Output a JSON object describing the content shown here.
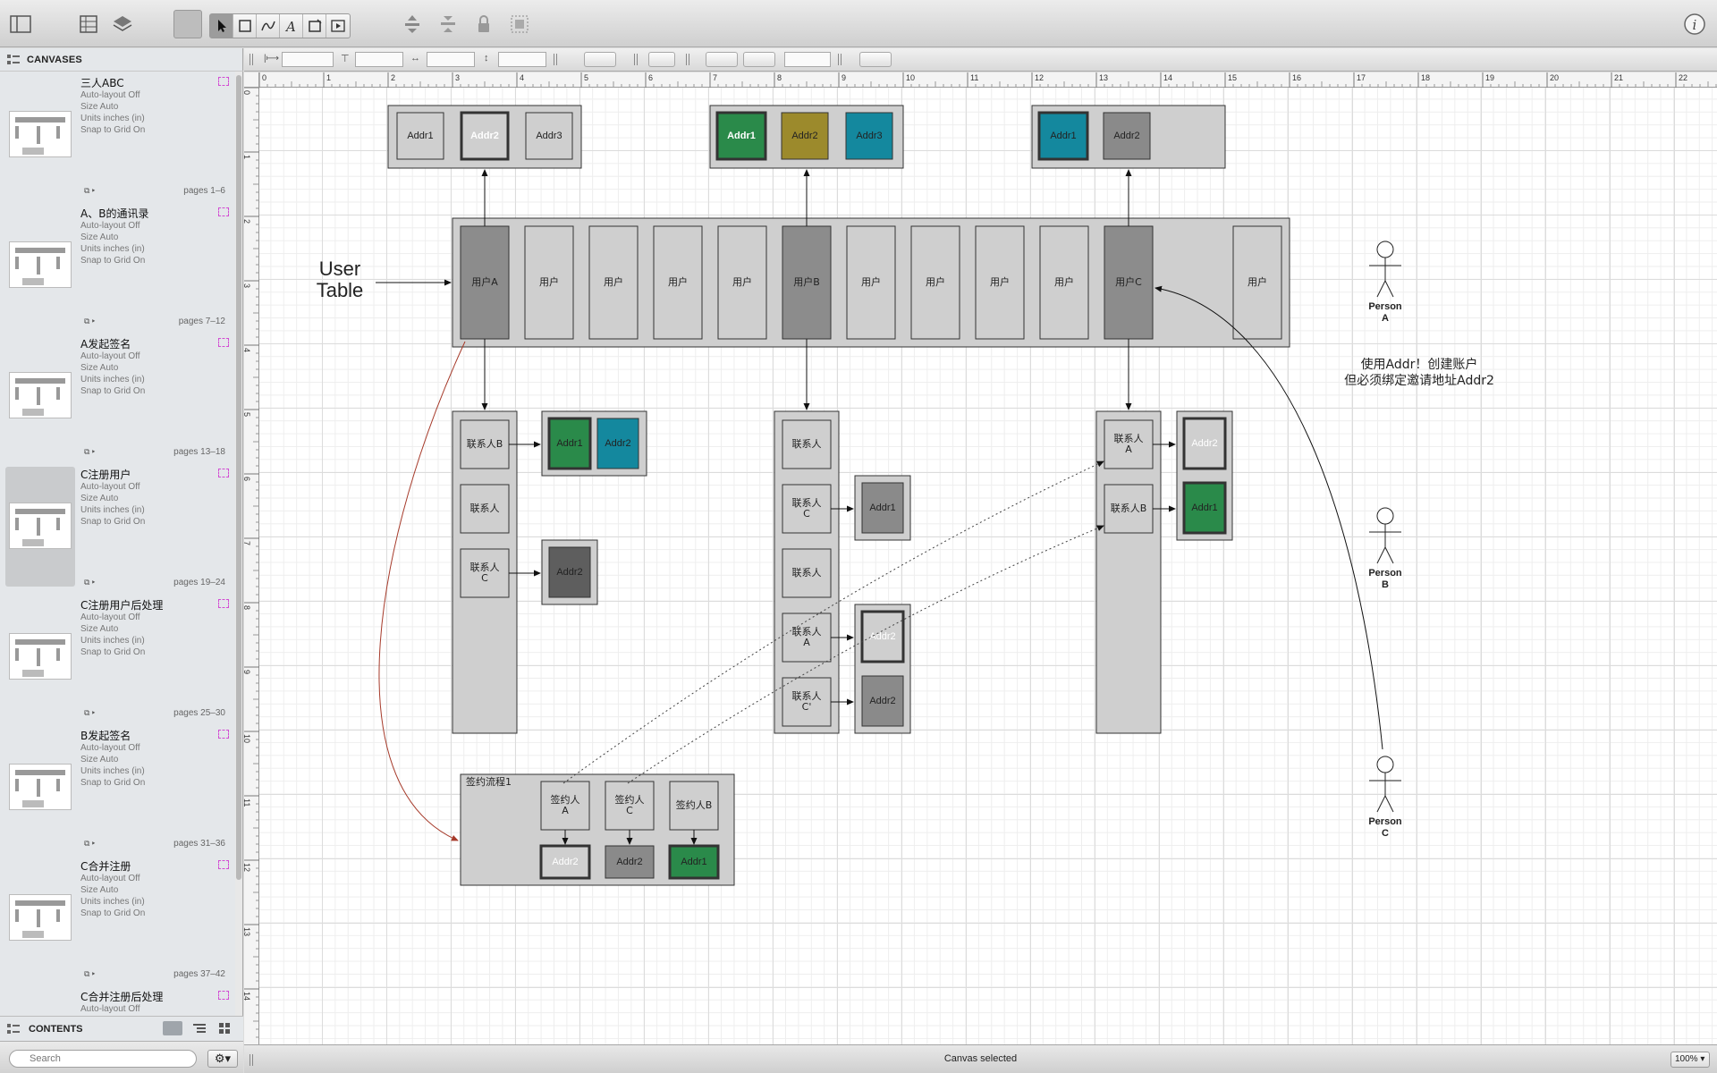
{
  "toolbar": {
    "icons": [
      "sidebar-toggle-icon",
      "canvas-grid-icon",
      "layers-icon",
      "style-well-icon",
      "select-tool-icon",
      "shape-tool-icon",
      "line-tool-icon",
      "text-tool-icon",
      "magnet-tool-icon",
      "presentation-icon",
      "bring-front-icon",
      "send-back-icon",
      "lock-icon",
      "group-icon",
      "info-icon"
    ]
  },
  "sidebar": {
    "header": "CANVASES",
    "canvases": [
      {
        "title": "三人ABC",
        "autolayout": "Auto-layout Off",
        "size": "Size Auto",
        "units": "Units inches (in)",
        "snap": "Snap to Grid On",
        "pages": "pages 1–6",
        "selected": false
      },
      {
        "title": "A、B的通讯录",
        "autolayout": "Auto-layout Off",
        "size": "Size Auto",
        "units": "Units inches (in)",
        "snap": "Snap to Grid On",
        "pages": "pages 7–12",
        "selected": false
      },
      {
        "title": "A发起签名",
        "autolayout": "Auto-layout Off",
        "size": "Size Auto",
        "units": "Units inches (in)",
        "snap": "Snap to Grid On",
        "pages": "pages 13–18",
        "selected": false
      },
      {
        "title": "C注册用户",
        "autolayout": "Auto-layout Off",
        "size": "Size Auto",
        "units": "Units inches (in)",
        "snap": "Snap to Grid On",
        "pages": "pages 19–24",
        "selected": true
      },
      {
        "title": "C注册用户后处理",
        "autolayout": "Auto-layout Off",
        "size": "Size Auto",
        "units": "Units inches (in)",
        "snap": "Snap to Grid On",
        "pages": "pages 25–30",
        "selected": false
      },
      {
        "title": "B发起签名",
        "autolayout": "Auto-layout Off",
        "size": "Size Auto",
        "units": "Units inches (in)",
        "snap": "Snap to Grid On",
        "pages": "pages 31–36",
        "selected": false
      },
      {
        "title": "C合并注册",
        "autolayout": "Auto-layout Off",
        "size": "Size Auto",
        "units": "Units inches (in)",
        "snap": "Snap to Grid On",
        "pages": "pages 37–42",
        "selected": false
      },
      {
        "title": "C合并注册后处理",
        "autolayout": "Auto-layout Off",
        "size": "",
        "units": "",
        "snap": "",
        "pages": "",
        "selected": false
      }
    ],
    "contents_label": "CONTENTS",
    "search_placeholder": "Search"
  },
  "ruler": {
    "h_ticks": [
      "0",
      "1",
      "2",
      "3",
      "4",
      "5",
      "6",
      "7",
      "8",
      "9",
      "10",
      "11",
      "12",
      "13",
      "14",
      "15",
      "16",
      "17",
      "18",
      "19",
      "20",
      "21",
      "22"
    ],
    "v_ticks": [
      "0",
      "1",
      "2",
      "3",
      "4",
      "5",
      "6",
      "7",
      "8",
      "9",
      "10",
      "11",
      "12",
      "13",
      "14"
    ]
  },
  "diagram": {
    "user_table_label": [
      "User",
      "Table"
    ],
    "addr_groups": [
      {
        "cells": [
          {
            "t": "Addr1",
            "fill": "#cfcfcf",
            "fg": "#222"
          },
          {
            "t": "Addr2",
            "fill": "#cfcfcf",
            "fg": "#fff",
            "bold": true,
            "thick": true
          },
          {
            "t": "Addr3",
            "fill": "#cfcfcf",
            "fg": "#222"
          }
        ]
      },
      {
        "cells": [
          {
            "t": "Addr1",
            "fill": "#2a8a4a",
            "fg": "#fff",
            "bold": true,
            "thick": true
          },
          {
            "t": "Addr2",
            "fill": "#9c8a2c",
            "fg": "#222"
          },
          {
            "t": "Addr3",
            "fill": "#14889e",
            "fg": "#222"
          }
        ]
      },
      {
        "cells": [
          {
            "t": "Addr1",
            "fill": "#14889e",
            "fg": "#222",
            "thick": true
          },
          {
            "t": "Addr2",
            "fill": "#8a8a8a",
            "fg": "#222"
          }
        ]
      }
    ],
    "users": [
      "用户A",
      "用户",
      "用户",
      "用户",
      "用户",
      "用户B",
      "用户",
      "用户",
      "用户",
      "用户",
      "用户C",
      "",
      "用户"
    ],
    "contacts_a": [
      "联系人B",
      "联系人",
      "联系人C"
    ],
    "contacts_b": [
      "联系人",
      "联系人C",
      "联系人",
      "联系人A",
      "联系人C'"
    ],
    "contacts_c": [
      "联系人A",
      "联系人B"
    ],
    "addr_a1": [
      {
        "t": "Addr1",
        "fill": "#2a8a4a",
        "fg": "#222",
        "thick": true
      },
      {
        "t": "Addr2",
        "fill": "#14889e",
        "fg": "#222"
      }
    ],
    "addr_a3": {
      "t": "Addr2",
      "fill": "#5e5e5e",
      "fg": "#222"
    },
    "addr_b2": {
      "t": "Addr1",
      "fill": "#8a8a8a",
      "fg": "#222"
    },
    "addr_b4": {
      "t": "Addr2",
      "fill": "#cfcfcf",
      "fg": "#fff",
      "thick": true
    },
    "addr_b5": {
      "t": "Addr2",
      "fill": "#8a8a8a",
      "fg": "#222"
    },
    "addr_c1": {
      "t": "Addr2",
      "fill": "#cfcfcf",
      "fg": "#fff",
      "thick": true
    },
    "addr_c2": {
      "t": "Addr1",
      "fill": "#2a8a4a",
      "fg": "#222",
      "thick": true
    },
    "flow": {
      "title": "签约流程1",
      "signers": [
        "签约人A",
        "签约人C",
        "签约人B"
      ],
      "addrs": [
        {
          "t": "Addr2",
          "fill": "#cfcfcf",
          "fg": "#fff",
          "thick": true
        },
        {
          "t": "Addr2",
          "fill": "#8a8a8a",
          "fg": "#222"
        },
        {
          "t": "Addr1",
          "fill": "#2a8a4a",
          "fg": "#222",
          "thick": true
        }
      ]
    },
    "persons": [
      "Person A",
      "Person B",
      "Person C"
    ],
    "note": [
      "使用Addr！创建账户",
      "但必须绑定邀请地址Addr2"
    ]
  },
  "status": {
    "text": "Canvas selected",
    "zoom": "100%"
  }
}
